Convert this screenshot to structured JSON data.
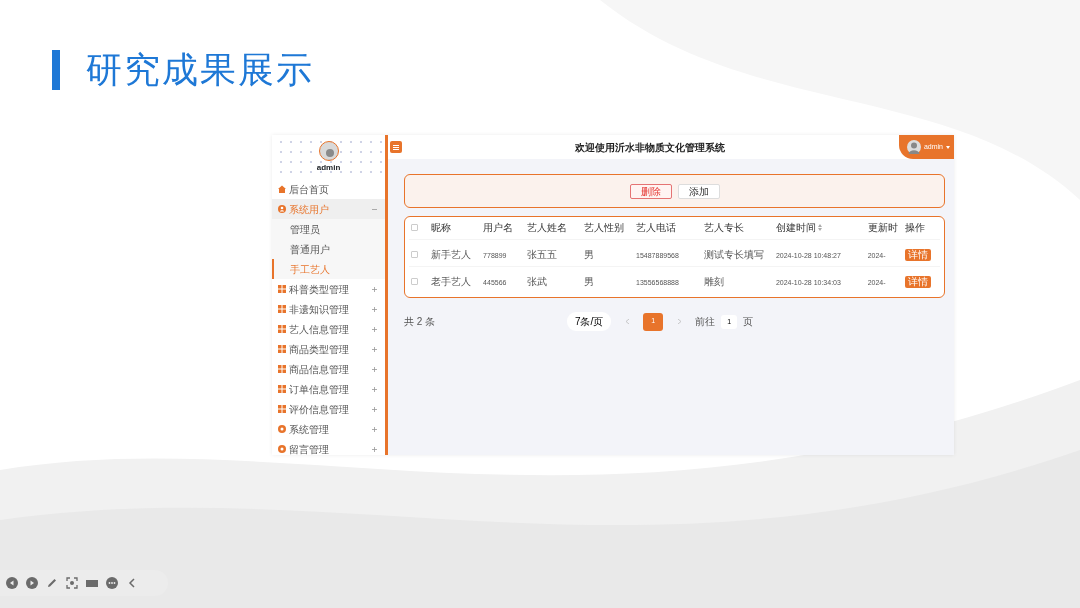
{
  "slide": {
    "title": "研究成果展示"
  },
  "app": {
    "header": {
      "title": "欢迎使用沂水非物质文化管理系统",
      "user": "admin"
    },
    "sidebar": {
      "username": "admin",
      "items": [
        {
          "label": "后台首页",
          "kind": "home",
          "selected": false
        },
        {
          "label": "系统用户",
          "kind": "users",
          "selected": true,
          "expanded": true,
          "children": [
            {
              "label": "管理员",
              "selected": false
            },
            {
              "label": "普通用户",
              "selected": false
            },
            {
              "label": "手工艺人",
              "selected": true
            }
          ]
        },
        {
          "label": "科普类型管理",
          "kind": "module",
          "selected": false,
          "expanded": false
        },
        {
          "label": "非遗知识管理",
          "kind": "module",
          "selected": false,
          "expanded": false
        },
        {
          "label": "艺人信息管理",
          "kind": "module",
          "selected": false,
          "expanded": false
        },
        {
          "label": "商品类型管理",
          "kind": "module",
          "selected": false,
          "expanded": false
        },
        {
          "label": "商品信息管理",
          "kind": "module",
          "selected": false,
          "expanded": false
        },
        {
          "label": "订单信息管理",
          "kind": "module",
          "selected": false,
          "expanded": false
        },
        {
          "label": "评价信息管理",
          "kind": "module",
          "selected": false,
          "expanded": false
        },
        {
          "label": "系统管理",
          "kind": "system",
          "selected": false,
          "expanded": false
        },
        {
          "label": "留言管理",
          "kind": "system",
          "selected": false,
          "expanded": false
        }
      ]
    },
    "toolbar": {
      "buttons": [
        {
          "label": "删除",
          "kind": "danger"
        },
        {
          "label": "添加",
          "kind": "plain"
        }
      ]
    },
    "table": {
      "select_all": {
        "checked": false
      },
      "columns": [
        {
          "label": "昵称",
          "kind": "text",
          "sortable": false
        },
        {
          "label": "用户名",
          "kind": "digits",
          "sortable": false
        },
        {
          "label": "艺人姓名",
          "kind": "text",
          "sortable": false
        },
        {
          "label": "艺人性别",
          "kind": "text",
          "sortable": false
        },
        {
          "label": "艺人电话",
          "kind": "digits",
          "sortable": false
        },
        {
          "label": "艺人专长",
          "kind": "text",
          "sortable": false
        },
        {
          "label": "创建时间",
          "kind": "digits",
          "sortable": true
        },
        {
          "label": "更新时",
          "kind": "digits",
          "sortable": false
        },
        {
          "label": "操作",
          "kind": "action",
          "sortable": false
        }
      ],
      "rows": [
        {
          "checked": false,
          "cells": [
            "新手艺人",
            "778899",
            "张五五",
            "男",
            "15487889568",
            "测试专长填写",
            "2024-10-28 10:48:27",
            "2024-",
            "详情"
          ]
        },
        {
          "checked": false,
          "cells": [
            "老手艺人",
            "445566",
            "张武",
            "男",
            "13556568888",
            "雕刻",
            "2024-10-28 10:34:03",
            "2024-",
            "详情"
          ]
        }
      ]
    },
    "pagination": {
      "total": "共 2 条",
      "page_size": "7条/页",
      "pages": [
        {
          "label": "1",
          "selected": true
        }
      ],
      "goto_label": "前往",
      "goto_value": "1",
      "goto_suffix": "页"
    }
  }
}
